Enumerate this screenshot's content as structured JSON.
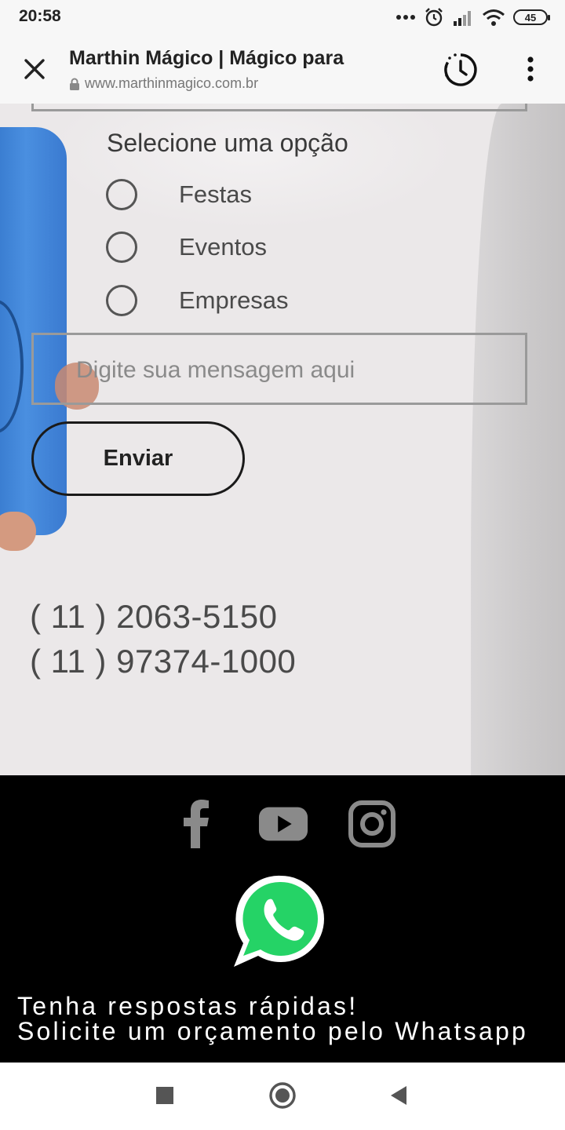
{
  "status_bar": {
    "time": "20:58",
    "battery": "45",
    "icons": [
      "more-dots-icon",
      "alarm-icon",
      "signal-icon",
      "wifi-icon",
      "battery-icon"
    ]
  },
  "browser": {
    "title": "Marthin Mágico | Mágico para",
    "url": "www.marthinmagico.com.br",
    "icons": [
      "close-icon",
      "lock-icon",
      "history-icon",
      "more-vert-icon"
    ]
  },
  "form": {
    "select_label": "Selecione uma opção",
    "options": [
      {
        "label": "Festas",
        "selected": false
      },
      {
        "label": "Eventos",
        "selected": false
      },
      {
        "label": "Empresas",
        "selected": false
      }
    ],
    "message_placeholder": "Digite sua mensagem aqui",
    "submit_label": "Enviar"
  },
  "contact": {
    "phones": [
      "( 11 ) 2063-5150",
      "( 11 ) 97374-1000"
    ]
  },
  "footer": {
    "social": [
      "facebook-icon",
      "youtube-icon",
      "instagram-icon"
    ],
    "whatsapp_icon": "whatsapp-icon",
    "cta_line1": "Tenha respostas rápidas!",
    "cta_line2": "Solicite um orçamento pelo Whatsapp"
  },
  "nav_bar": {
    "icons": [
      "recents-icon",
      "home-icon",
      "back-icon"
    ]
  },
  "colors": {
    "content_bg": "#ebe8e9",
    "footer_bg": "#000000",
    "whatsapp_green": "#25d366",
    "social_gray": "#8a8a8a"
  }
}
